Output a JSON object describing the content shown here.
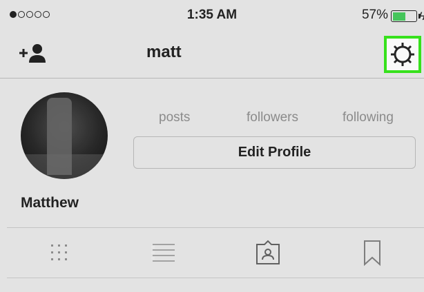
{
  "status_bar": {
    "signal_dots": 5,
    "signal_filled": 1,
    "time": "1:35 AM",
    "battery_percent": "57%",
    "battery_level": 0.57
  },
  "nav": {
    "username": "matt"
  },
  "profile": {
    "stats": [
      "posts",
      "followers",
      "following"
    ],
    "edit_button": "Edit Profile",
    "full_name": "Matthew"
  },
  "tabs": [
    {
      "icon": "grid-icon"
    },
    {
      "icon": "list-icon"
    },
    {
      "icon": "tagged-photos-icon"
    },
    {
      "icon": "bookmark-icon"
    }
  ],
  "colors": {
    "highlight": "#37e11c",
    "battery": "#4cd964",
    "muted_text": "#999999",
    "divider": "#c8c8c8"
  }
}
